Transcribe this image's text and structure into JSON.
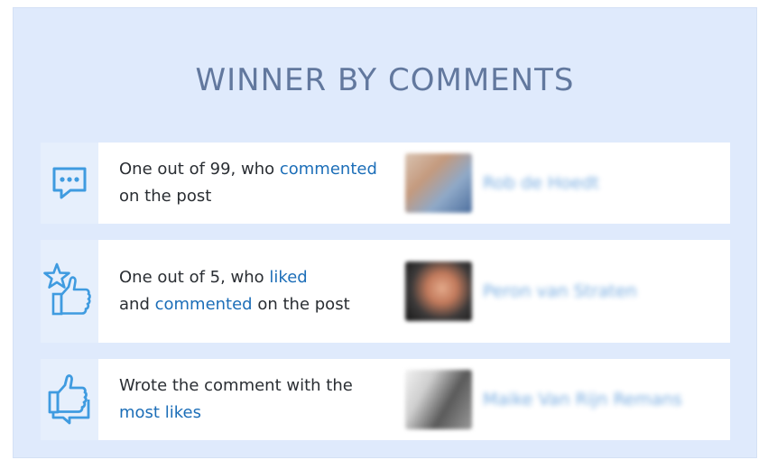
{
  "title": "WINNER BY COMMENTS",
  "colors": {
    "panel_bg": "#dfeafc",
    "title": "#62789e",
    "highlight": "#1c6eb8",
    "icon": "#3f9be0"
  },
  "rows": [
    {
      "icon": "chat-bubble-icon",
      "text": [
        {
          "t": "One out of 99, who ",
          "hl": false
        },
        {
          "t": "commented",
          "hl": true
        },
        {
          "t": " on the post",
          "hl": false
        }
      ],
      "winner_name": "Rob de Hoedt"
    },
    {
      "icon": "star-thumbs-up-icon",
      "text": [
        {
          "t": "One out of 5, who ",
          "hl": false
        },
        {
          "t": "liked",
          "hl": true
        },
        {
          "t": " and ",
          "hl": false
        },
        {
          "t": "commented",
          "hl": true
        },
        {
          "t": " on the post",
          "hl": false
        }
      ],
      "winner_name": "Peron van Straten"
    },
    {
      "icon": "thumbs-up-bubble-icon",
      "text": [
        {
          "t": "Wrote the comment with the ",
          "hl": false
        },
        {
          "t": "most likes",
          "hl": true
        }
      ],
      "winner_name": "Maike Van Rijn Remans"
    }
  ]
}
